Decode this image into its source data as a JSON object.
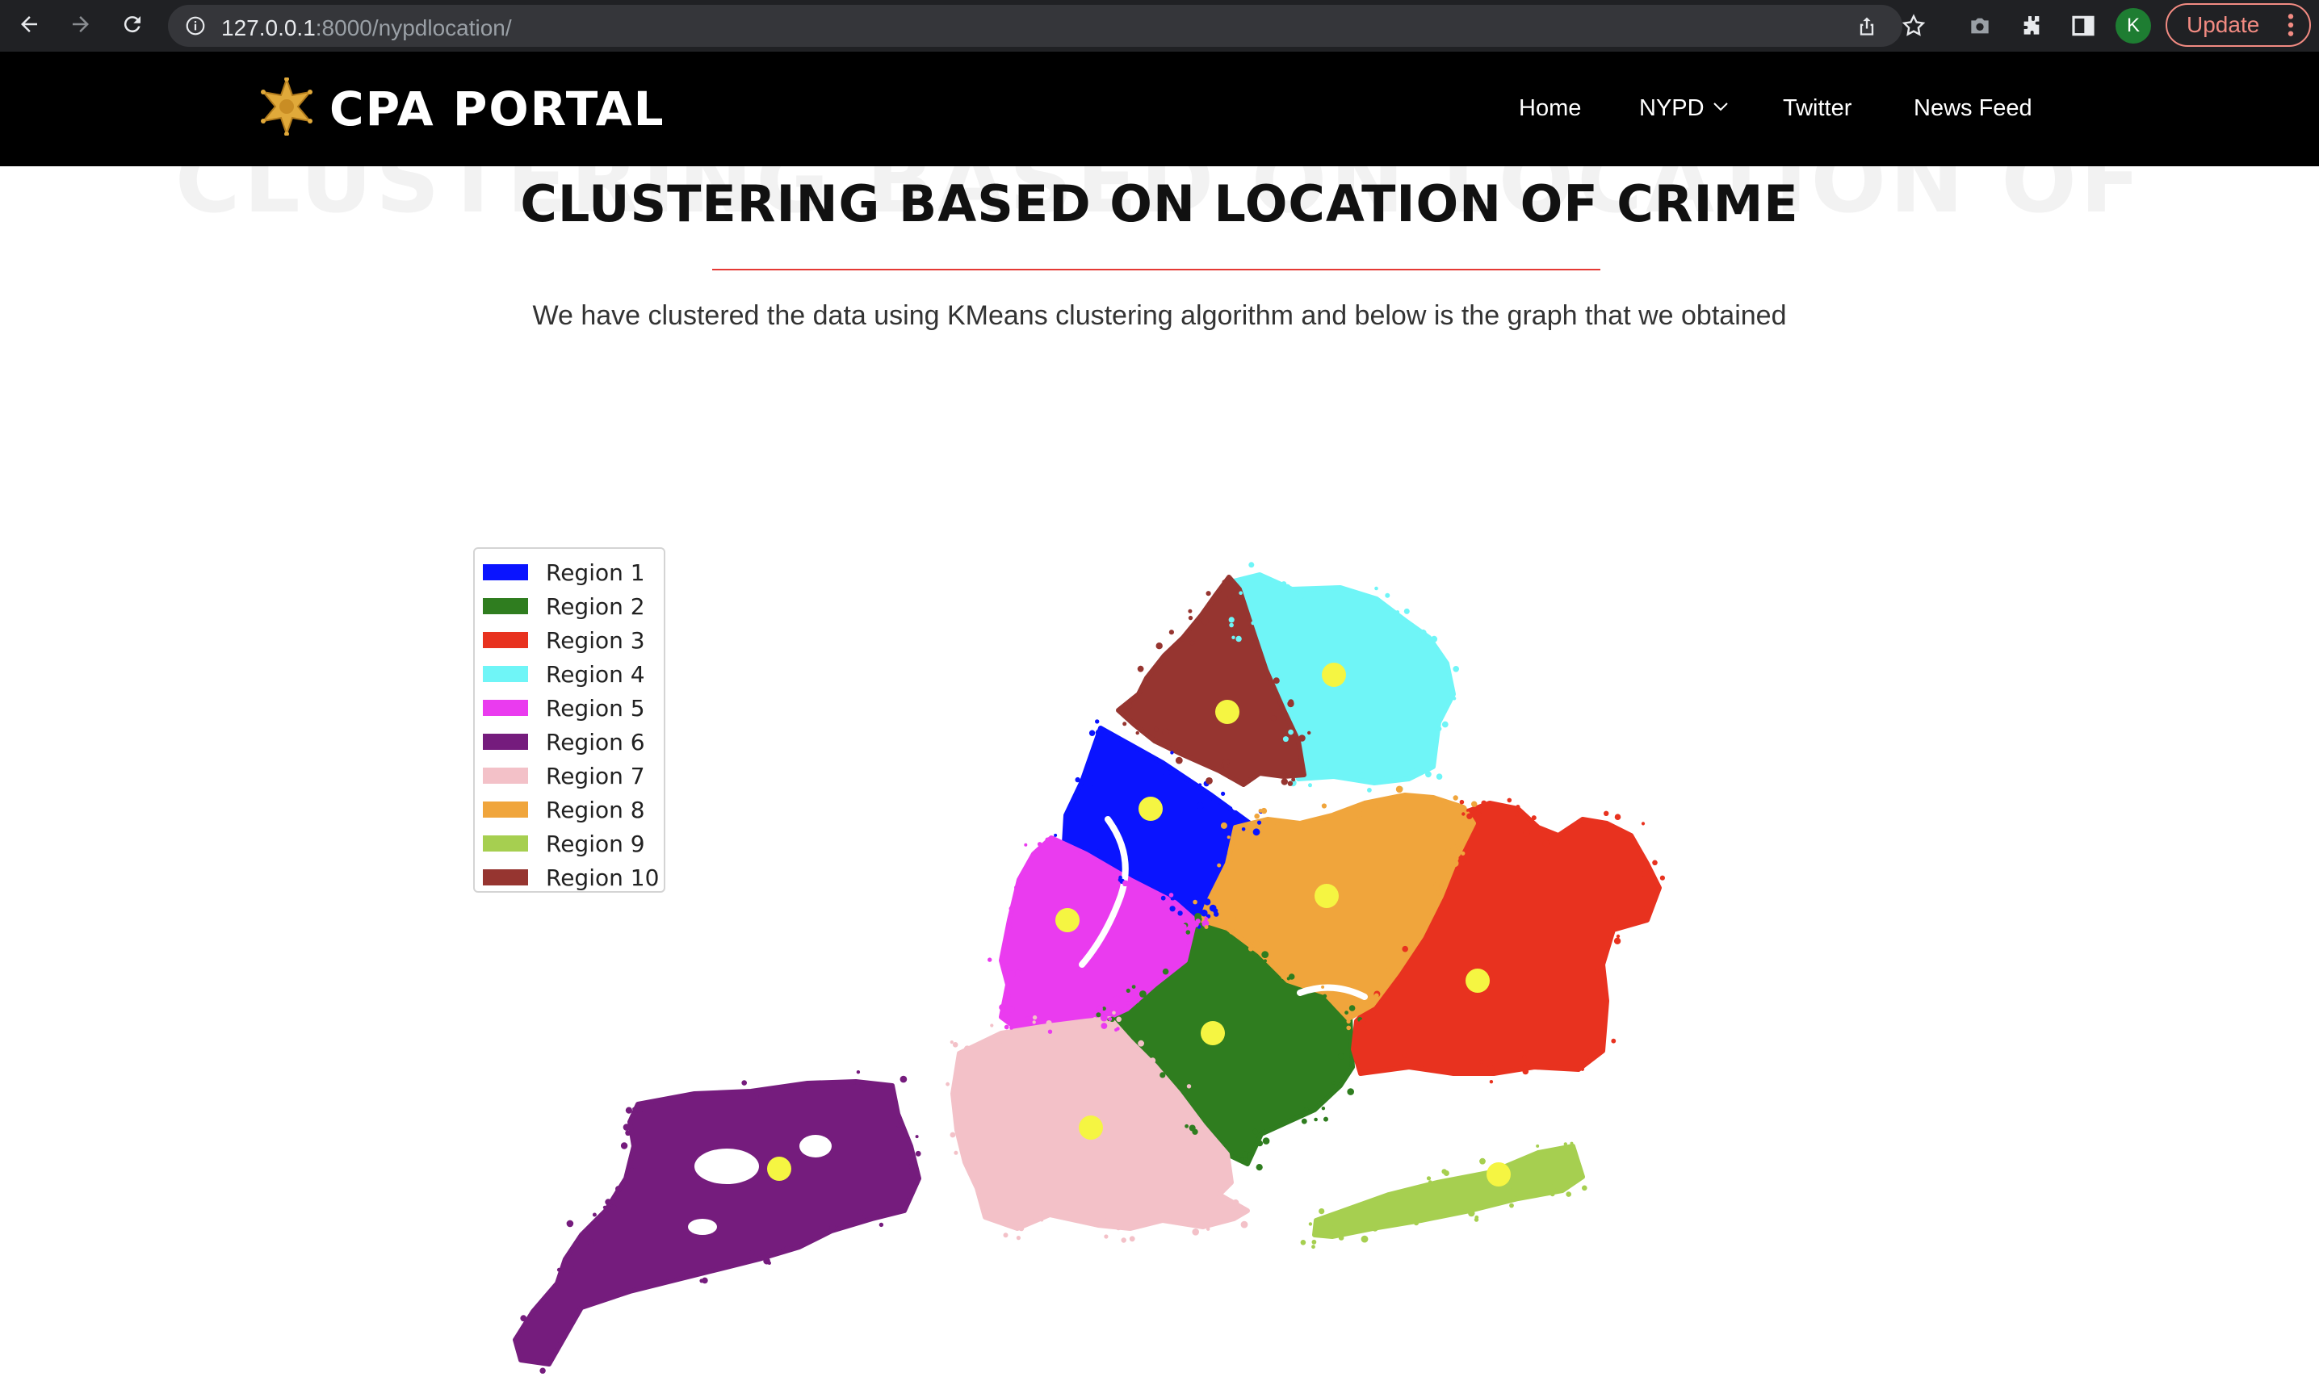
{
  "browser": {
    "url_host": "127.0.0.1",
    "url_path": ":8000/nypdlocation/",
    "profile_initial": "K",
    "update_label": "Update"
  },
  "header": {
    "brand": "CPA PORTAL",
    "nav": [
      {
        "label": "Home"
      },
      {
        "label": "NYPD"
      },
      {
        "label": "Twitter"
      },
      {
        "label": "News Feed"
      }
    ]
  },
  "main": {
    "ghost_title": "CLUSTERING BASED ON LOCATION OF",
    "title": "CLUSTERING BASED ON LOCATION OF CRIME",
    "subtitle": "We have clustered the data using KMeans clustering algorithm and below is the graph that we obtained"
  },
  "chart_data": {
    "type": "scatter",
    "centroid_color": "#f5f542",
    "series": [
      {
        "name": "Region 1",
        "color": "#0a14ff"
      },
      {
        "name": "Region 2",
        "color": "#2f7d1f"
      },
      {
        "name": "Region 3",
        "color": "#e8321f"
      },
      {
        "name": "Region 4",
        "color": "#6ff5f7"
      },
      {
        "name": "Region 5",
        "color": "#ea3bef"
      },
      {
        "name": "Region 6",
        "color": "#751c7d"
      },
      {
        "name": "Region 7",
        "color": "#f3c1c8"
      },
      {
        "name": "Region 8",
        "color": "#f0a53c"
      },
      {
        "name": "Region 9",
        "color": "#a6cf50"
      },
      {
        "name": "Region 10",
        "color": "#963530"
      }
    ]
  }
}
